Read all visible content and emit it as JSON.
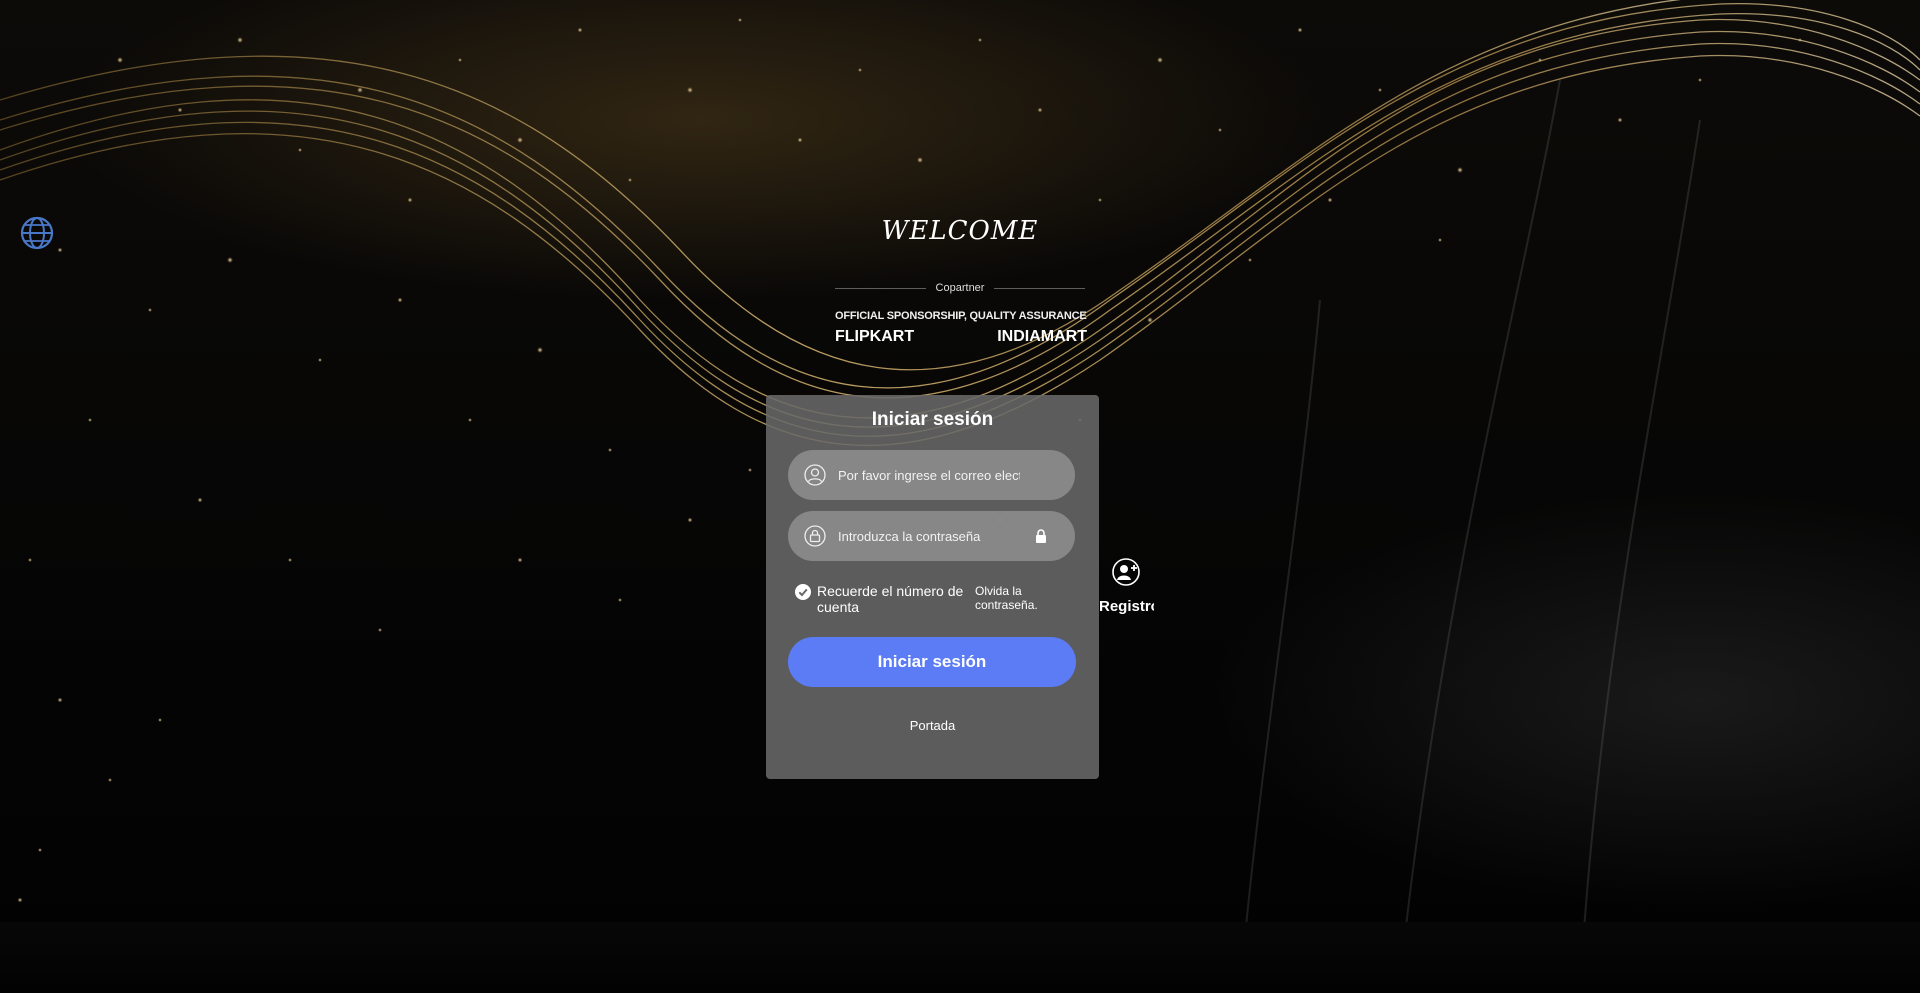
{
  "header": {
    "welcome": "WELCOME",
    "copartner": "Copartner",
    "official": "OFFICIAL SPONSORSHIP, QUALITY ASSURANCE",
    "brands": [
      "FLIPKART",
      "INDIAMART"
    ]
  },
  "language": {
    "icon": "globe-icon"
  },
  "login": {
    "title": "Iniciar sesión",
    "email_placeholder": "Por favor ingrese el correo electrónico",
    "password_placeholder": "Introduzca la contraseña",
    "remember_label": "Recuerde el número de cuenta",
    "remember_checked": true,
    "forgot_label": "Olvida la contraseña.",
    "submit_label": "Iniciar sesión",
    "home_link": "Portada"
  },
  "register": {
    "label": "Registro",
    "icon": "user-add-icon"
  },
  "colors": {
    "accent": "#5b7cf4",
    "card": "#696969",
    "gold": "#c9a24a"
  }
}
